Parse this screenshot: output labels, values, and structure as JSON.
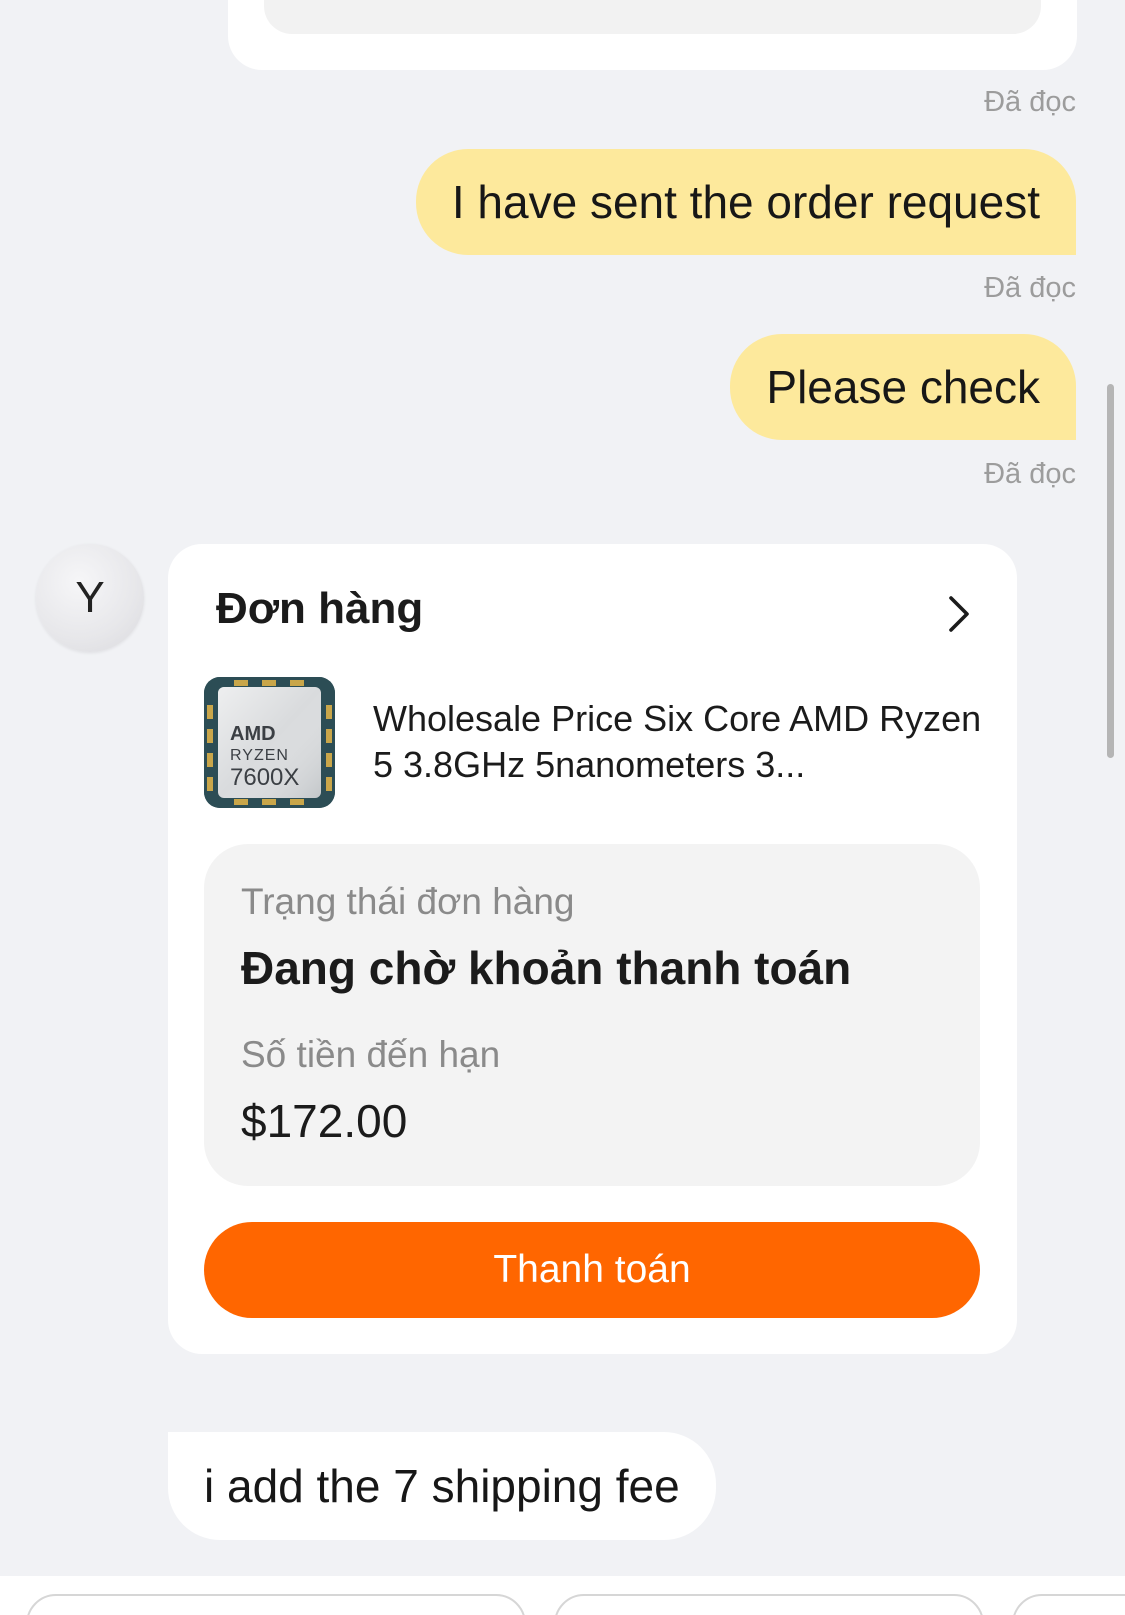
{
  "messages": {
    "read_label": "Đã đọc",
    "outgoing": [
      {
        "text": "I have sent the order request"
      },
      {
        "text": "Please check"
      }
    ],
    "incoming_text": "i add the 7 shipping fee"
  },
  "sender": {
    "avatar_initial": "Y"
  },
  "order_card": {
    "title": "Đơn hàng",
    "product": {
      "image_text": [
        "AMD",
        "RYZEN",
        "7600X"
      ],
      "title": "Wholesale Price Six Core AMD Ryzen 5 3.8GHz 5nanometers 3..."
    },
    "status_label": "Trạng thái đơn hàng",
    "status_value": "Đang chờ khoản thanh toán",
    "amount_label": "Số tiền đến hạn",
    "amount_value": "$172.00",
    "pay_button_label": "Thanh toán"
  },
  "colors": {
    "outgoing_bubble": "#fde99c",
    "pay_button": "#ff6600",
    "background": "#f1f2f5"
  },
  "icons": [
    "chevron-right-icon"
  ]
}
